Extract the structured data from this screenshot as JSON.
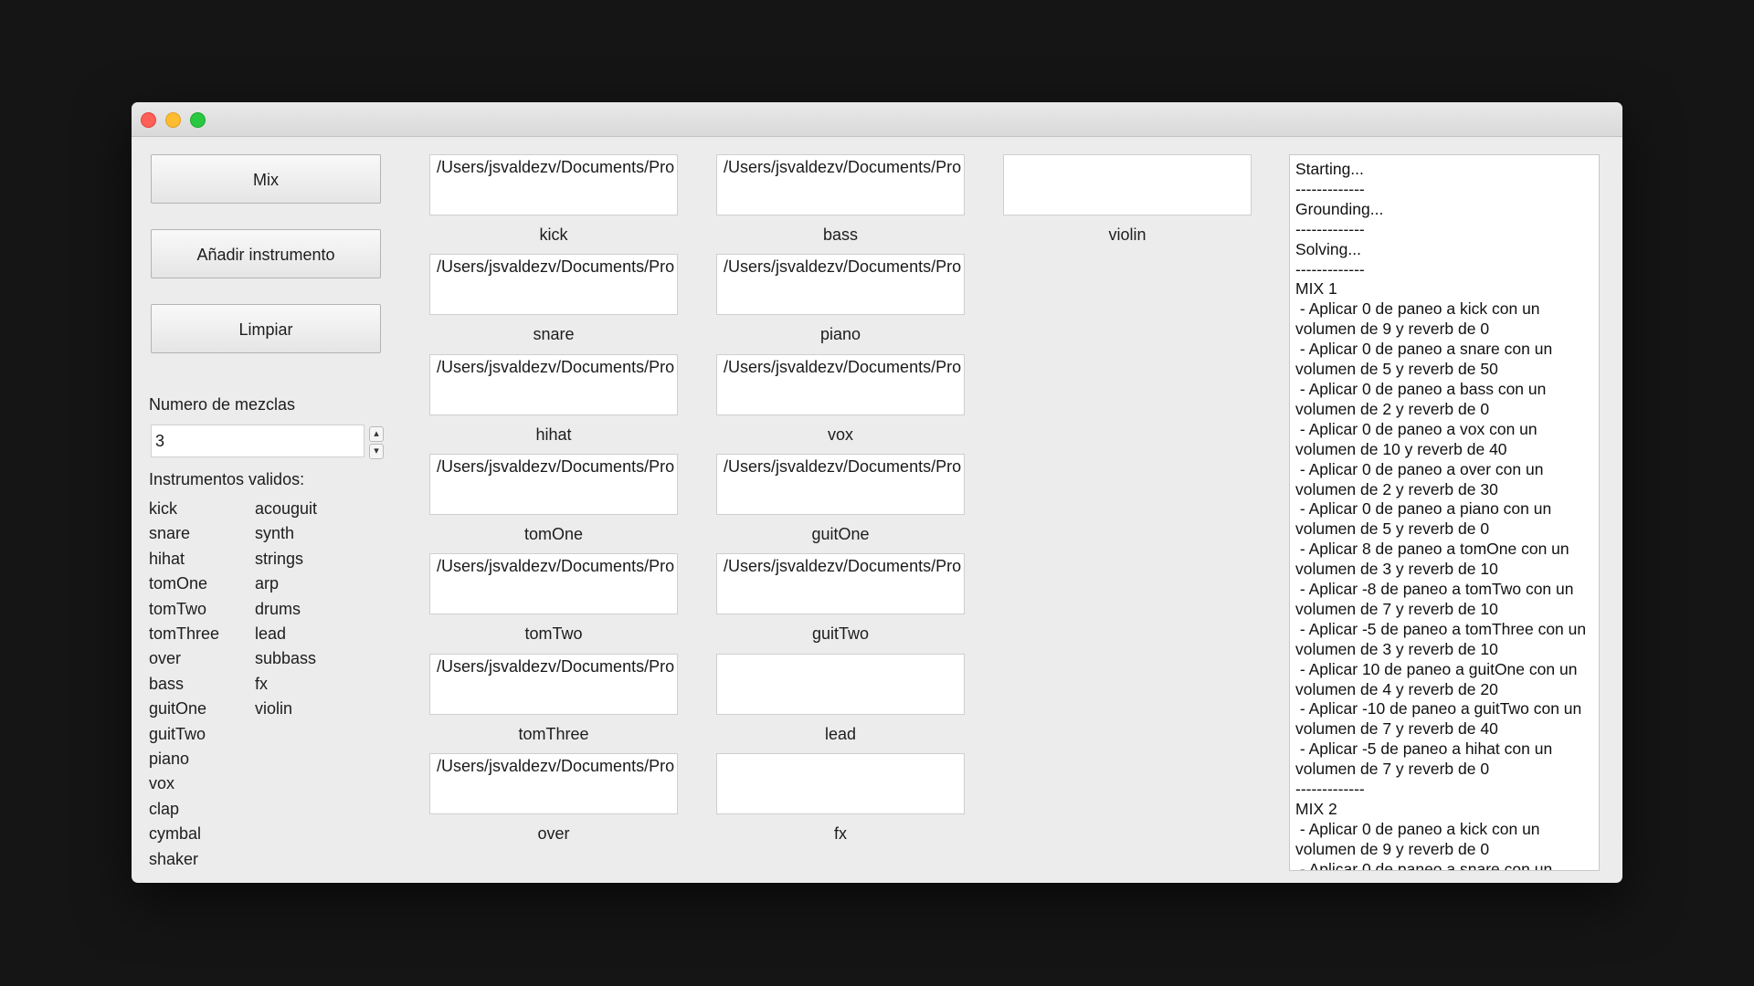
{
  "window": {
    "controls": [
      "close",
      "minimize",
      "zoom"
    ]
  },
  "buttons": {
    "mix": "Mix",
    "add_instrument": "Añadir instrumento",
    "clear": "Limpiar"
  },
  "mix_count": {
    "label": "Numero de mezclas",
    "value": "3"
  },
  "valid_instruments": {
    "label": "Instrumentos validos:",
    "col1": [
      "kick",
      "snare",
      "hihat",
      "tomOne",
      "tomTwo",
      "tomThree",
      "over",
      "bass",
      "guitOne",
      "guitTwo",
      "piano",
      "vox",
      "clap",
      "cymbal",
      "shaker"
    ],
    "col2": [
      "acouguit",
      "synth",
      "strings",
      "arp",
      "drums",
      "lead",
      "subbass",
      "fx",
      "violin"
    ]
  },
  "slots": {
    "col1": [
      {
        "path": "/Users/jsvaldezv/Documents/Pro",
        "label": "kick"
      },
      {
        "path": "/Users/jsvaldezv/Documents/Pro",
        "label": "snare"
      },
      {
        "path": "/Users/jsvaldezv/Documents/Pro",
        "label": "hihat"
      },
      {
        "path": "/Users/jsvaldezv/Documents/Pro",
        "label": "tomOne"
      },
      {
        "path": "/Users/jsvaldezv/Documents/Pro",
        "label": "tomTwo"
      },
      {
        "path": "/Users/jsvaldezv/Documents/Pro",
        "label": "tomThree"
      },
      {
        "path": "/Users/jsvaldezv/Documents/Pro",
        "label": "over"
      }
    ],
    "col2": [
      {
        "path": "/Users/jsvaldezv/Documents/Pro",
        "label": "bass"
      },
      {
        "path": "/Users/jsvaldezv/Documents/Pro",
        "label": "piano"
      },
      {
        "path": "/Users/jsvaldezv/Documents/Pro",
        "label": "vox"
      },
      {
        "path": "/Users/jsvaldezv/Documents/Pro",
        "label": "guitOne"
      },
      {
        "path": "/Users/jsvaldezv/Documents/Pro",
        "label": "guitTwo"
      },
      {
        "path": "",
        "label": "lead"
      },
      {
        "path": "",
        "label": "fx"
      }
    ],
    "col3": [
      {
        "path": "",
        "label": "violin"
      }
    ]
  },
  "console": {
    "lines": [
      "Starting...",
      "-------------",
      "Grounding...",
      "-------------",
      "Solving...",
      "-------------",
      "MIX 1",
      " - Aplicar 0 de paneo a kick con un volumen de 9 y reverb de 0",
      " - Aplicar 0 de paneo a snare con un volumen de 5 y reverb de 50",
      " - Aplicar 0 de paneo a bass con un volumen de 2 y reverb de 0",
      " - Aplicar 0 de paneo a vox con un volumen de 10 y reverb de 40",
      " - Aplicar 0 de paneo a over con un volumen de 2 y reverb de 30",
      " - Aplicar 0 de paneo a piano con un volumen de 5 y reverb de 0",
      " - Aplicar 8 de paneo a tomOne con un volumen de 3 y reverb de 10",
      " - Aplicar -8 de paneo a tomTwo con un volumen de 7 y reverb de 10",
      " - Aplicar -5 de paneo a tomThree con un volumen de 3 y reverb de 10",
      " - Aplicar 10 de paneo a guitOne con un volumen de 4 y reverb de 20",
      " - Aplicar -10 de paneo a guitTwo con un volumen de 7 y reverb de 40",
      " - Aplicar -5 de paneo a hihat con un volumen de 7 y reverb de 0",
      "-------------",
      "MIX 2",
      " - Aplicar 0 de paneo a kick con un volumen de 9 y reverb de 0",
      " - Aplicar 0 de paneo a snare con un"
    ]
  }
}
